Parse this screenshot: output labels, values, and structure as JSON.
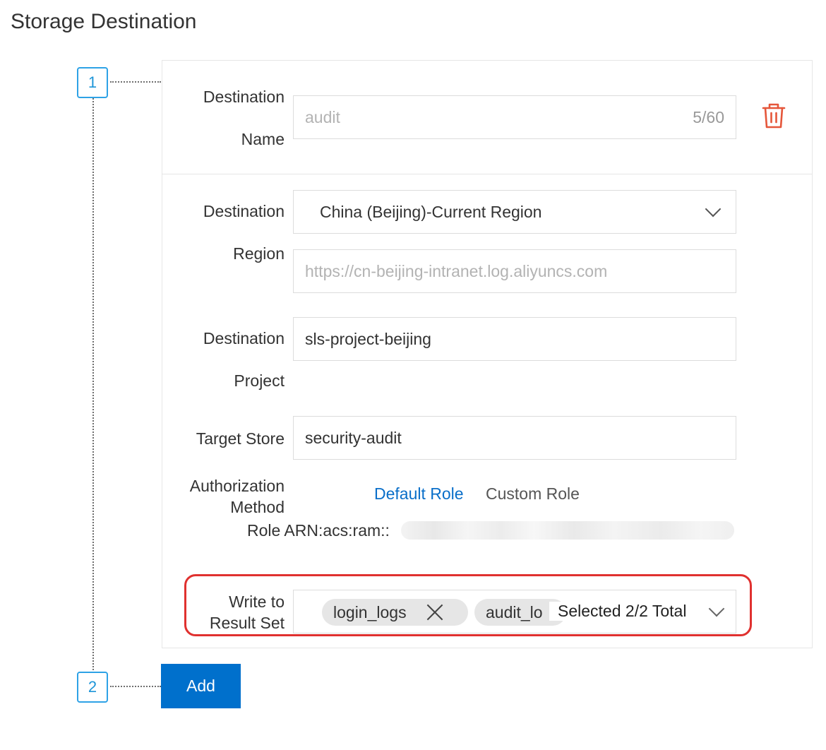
{
  "page": {
    "title": "Storage Destination"
  },
  "steps": [
    "1",
    "2"
  ],
  "form": {
    "destination_name": {
      "label_line1": "Destination",
      "label_line2": "Name",
      "placeholder": "audit",
      "counter": "5/60"
    },
    "destination_region": {
      "label_line1": "Destination",
      "label_line2": "Region",
      "selected": "China (Beijing)-Current Region",
      "endpoint_placeholder": "https://cn-beijing-intranet.log.aliyuncs.com"
    },
    "destination_project": {
      "label_line1": "Destination",
      "label_line2": "Project",
      "value": "sls-project-beijing"
    },
    "target_store": {
      "label": "Target Store",
      "value": "security-audit"
    },
    "authorization": {
      "label_line1": "Authorization",
      "label_line2": "Method",
      "options": [
        "Default Role",
        "Custom Role"
      ],
      "selected": "Default Role",
      "role_arn_label": "Role ARN:acs:ram::"
    },
    "result_set": {
      "label_line1": "Write to",
      "label_line2": "Result Set",
      "tags": [
        "login_logs",
        "audit_lo"
      ],
      "summary": "Selected 2/2 Total"
    }
  },
  "actions": {
    "add_label": "Add"
  },
  "colors": {
    "accent": "#0070cc",
    "link": "#0a6fc9",
    "danger": "#e0312f",
    "step_border": "#2ea2e6"
  },
  "icons": {
    "delete": "trash-icon",
    "dropdown": "chevron-down-icon",
    "remove_tag": "close-icon"
  }
}
